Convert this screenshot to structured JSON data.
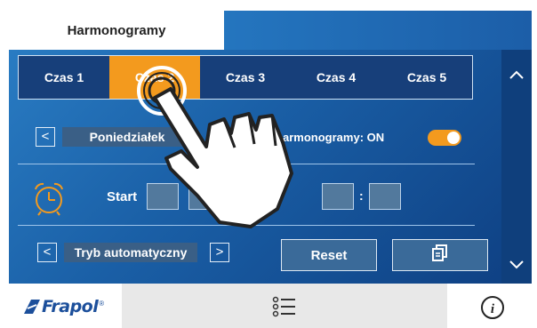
{
  "header": {
    "title": "Harmonogramy"
  },
  "times": {
    "tabs": [
      "Czas 1",
      "Czas 2",
      "Czas 3",
      "Czas 4",
      "Czas 5"
    ],
    "active_index": 1
  },
  "schedule": {
    "prev_day": "<",
    "next_day": ">",
    "day": "Poniedziałek",
    "harmonogramy_label": "armonogramy:  ON",
    "toggle_on": true
  },
  "time_row": {
    "start_label": "Start",
    "separator": ":"
  },
  "mode": {
    "prev": "<",
    "next": ">",
    "value": "Tryb automatyczny"
  },
  "buttons": {
    "reset": "Reset"
  },
  "footer": {
    "logo": "Frapol",
    "logo_mark": "®"
  },
  "colors": {
    "accent": "#f39a1e",
    "panel_blue": "#1a5fa6",
    "logo_blue": "#1c4f9b"
  },
  "icons": [
    "clock-icon",
    "menu-list-icon",
    "info-icon",
    "copy-icon",
    "chevron-up-icon",
    "chevron-down-icon",
    "hand-pointer-icon"
  ]
}
